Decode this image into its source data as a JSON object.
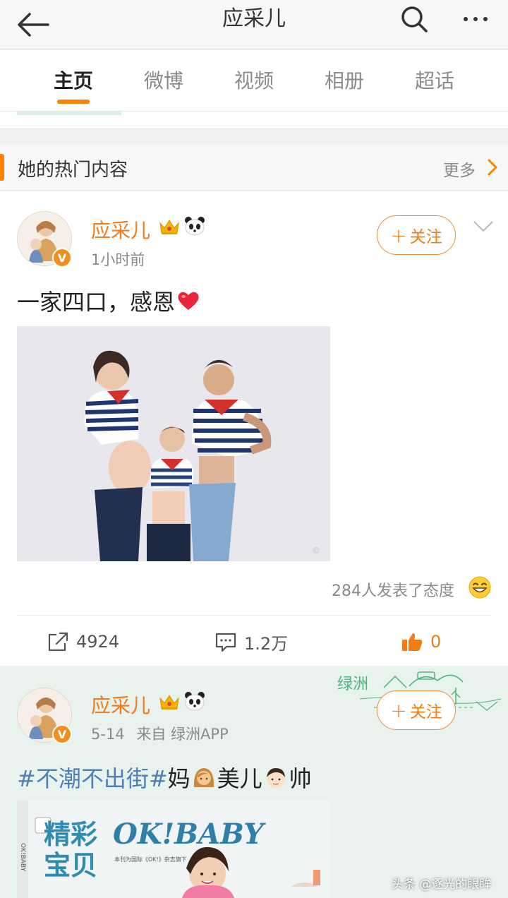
{
  "header": {
    "title": "应采儿",
    "back_icon": "back-arrow-icon",
    "search_icon": "search-icon",
    "more_icon": "more-dots-icon"
  },
  "tabs": [
    {
      "label": "主页",
      "active": true
    },
    {
      "label": "微博",
      "active": false
    },
    {
      "label": "视频",
      "active": false
    },
    {
      "label": "相册",
      "active": false
    },
    {
      "label": "超话",
      "active": false
    }
  ],
  "hot_section": {
    "title": "她的热门内容",
    "more_label": "更多"
  },
  "posts": [
    {
      "username": "应采儿",
      "time": "1小时前",
      "follow_label": "关注",
      "text": "一家四口，感恩",
      "reaction_text": "284人发表了态度",
      "repost_count": "4924",
      "comment_count": "1.2万",
      "like_count": "0"
    },
    {
      "username": "应采儿",
      "time": "5-14",
      "source": "来自 绿洲APP",
      "follow_label": "关注",
      "hashtag": "#不潮不出街#",
      "text_a": "妈",
      "text_b": "美儿",
      "text_c": "帅",
      "magazine_title": "精彩宝贝",
      "magazine_brand": "OK!BABY",
      "oasis_label": "绿洲"
    }
  ],
  "watermark": "头条 @逐光的眼眸",
  "colors": {
    "accent": "#ff8200",
    "username": "#f17a1b",
    "hashtag": "#4d7fbb",
    "like": "#f07d16"
  }
}
